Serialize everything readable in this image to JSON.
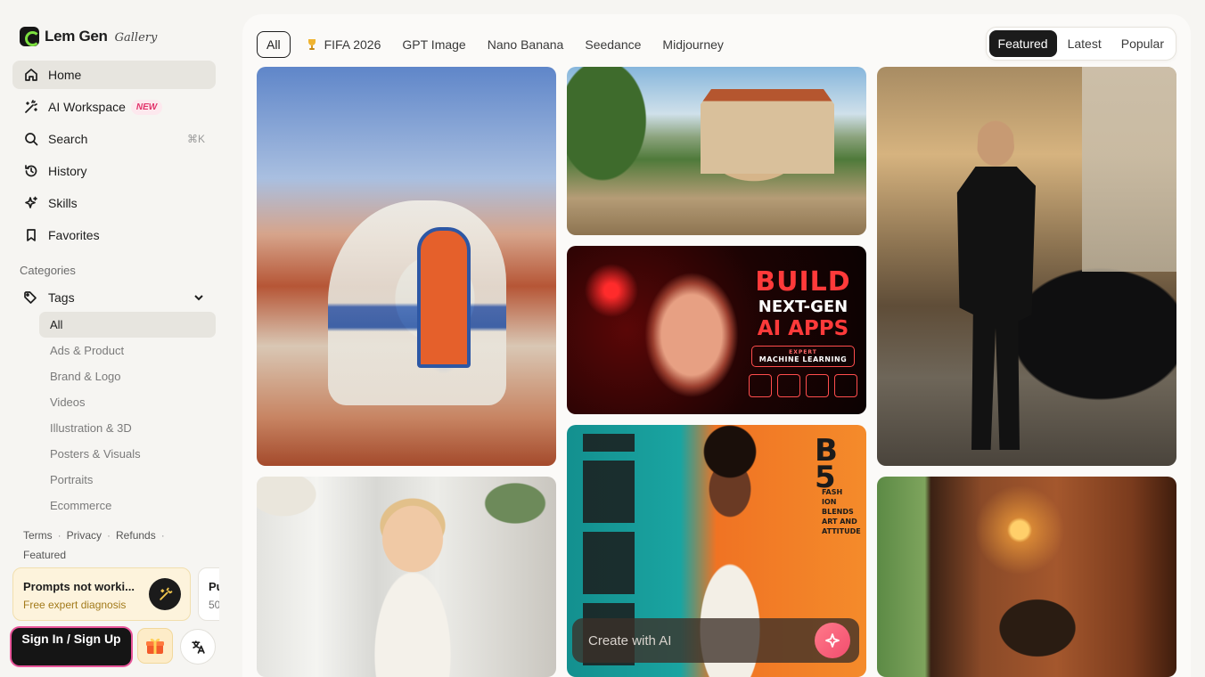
{
  "brand": {
    "name": "Lem Gen",
    "sub": "Gallery"
  },
  "nav": {
    "home": "Home",
    "workspace": "AI Workspace",
    "workspace_badge": "NEW",
    "search": "Search",
    "search_shortcut": "⌘K",
    "history": "History",
    "skills": "Skills",
    "favorites": "Favorites"
  },
  "categories": {
    "title": "Categories",
    "tags_label": "Tags",
    "items": [
      "All",
      "Ads & Product",
      "Brand & Logo",
      "Videos",
      "Illustration & 3D",
      "Posters & Visuals",
      "Portraits",
      "Ecommerce"
    ],
    "selected": "All"
  },
  "footer": {
    "terms": "Terms",
    "privacy": "Privacy",
    "refunds": "Refunds",
    "featured": "Featured"
  },
  "promos": [
    {
      "title": "Prompts not worki...",
      "subtitle": "Free expert diagnosis"
    },
    {
      "title": "Pu",
      "subtitle": "50"
    }
  ],
  "auth": {
    "sign_in": "Sign In / Sign Up"
  },
  "filters": {
    "items": [
      "All",
      "FIFA 2026",
      "GPT Image",
      "Nano Banana",
      "Seedance",
      "Midjourney"
    ],
    "selected": "All"
  },
  "sort": {
    "items": [
      "Featured",
      "Latest",
      "Popular"
    ],
    "selected": "Featured"
  },
  "gallery": {
    "ai_poster": {
      "l1": "BUILD",
      "l2": "NEXT-GEN",
      "l3": "AI APPS",
      "sub1": "EXPERT",
      "sub2": "MACHINE LEARNING"
    },
    "fashion_poster": {
      "big": "B\n5",
      "lines": "FASH\nION\nBLENDS\nART AND\nATTITUDE"
    }
  },
  "create": {
    "placeholder": "Create with AI"
  },
  "colors": {
    "accent": "#1b1b1b",
    "badge_new": "#e2336b",
    "promo_bg": "#fdf3dc",
    "create_button": "#f24d6e"
  }
}
